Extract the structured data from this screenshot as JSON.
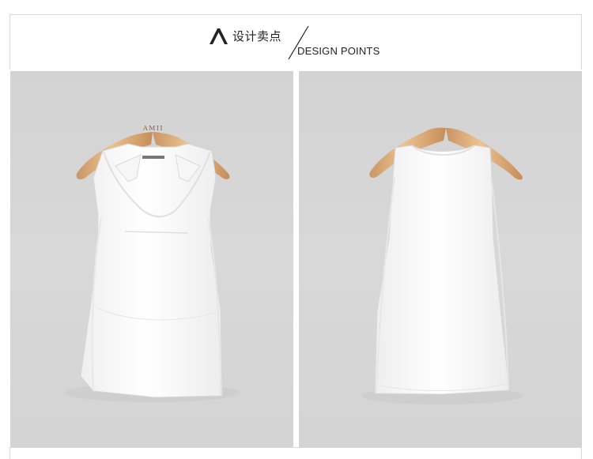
{
  "header": {
    "title_cn": "设计卖点",
    "title_en": "DESIGN POINTS",
    "accent_color": "#222222",
    "brand_icon": "lambda-icon"
  },
  "photos": [
    {
      "view": "front",
      "hanger_logo": "AMII",
      "garment_color": "#fbfbfb",
      "background_color": "#d5d5d5"
    },
    {
      "view": "back",
      "garment_color": "#fbfbfb",
      "background_color": "#d5d5d5"
    }
  ]
}
